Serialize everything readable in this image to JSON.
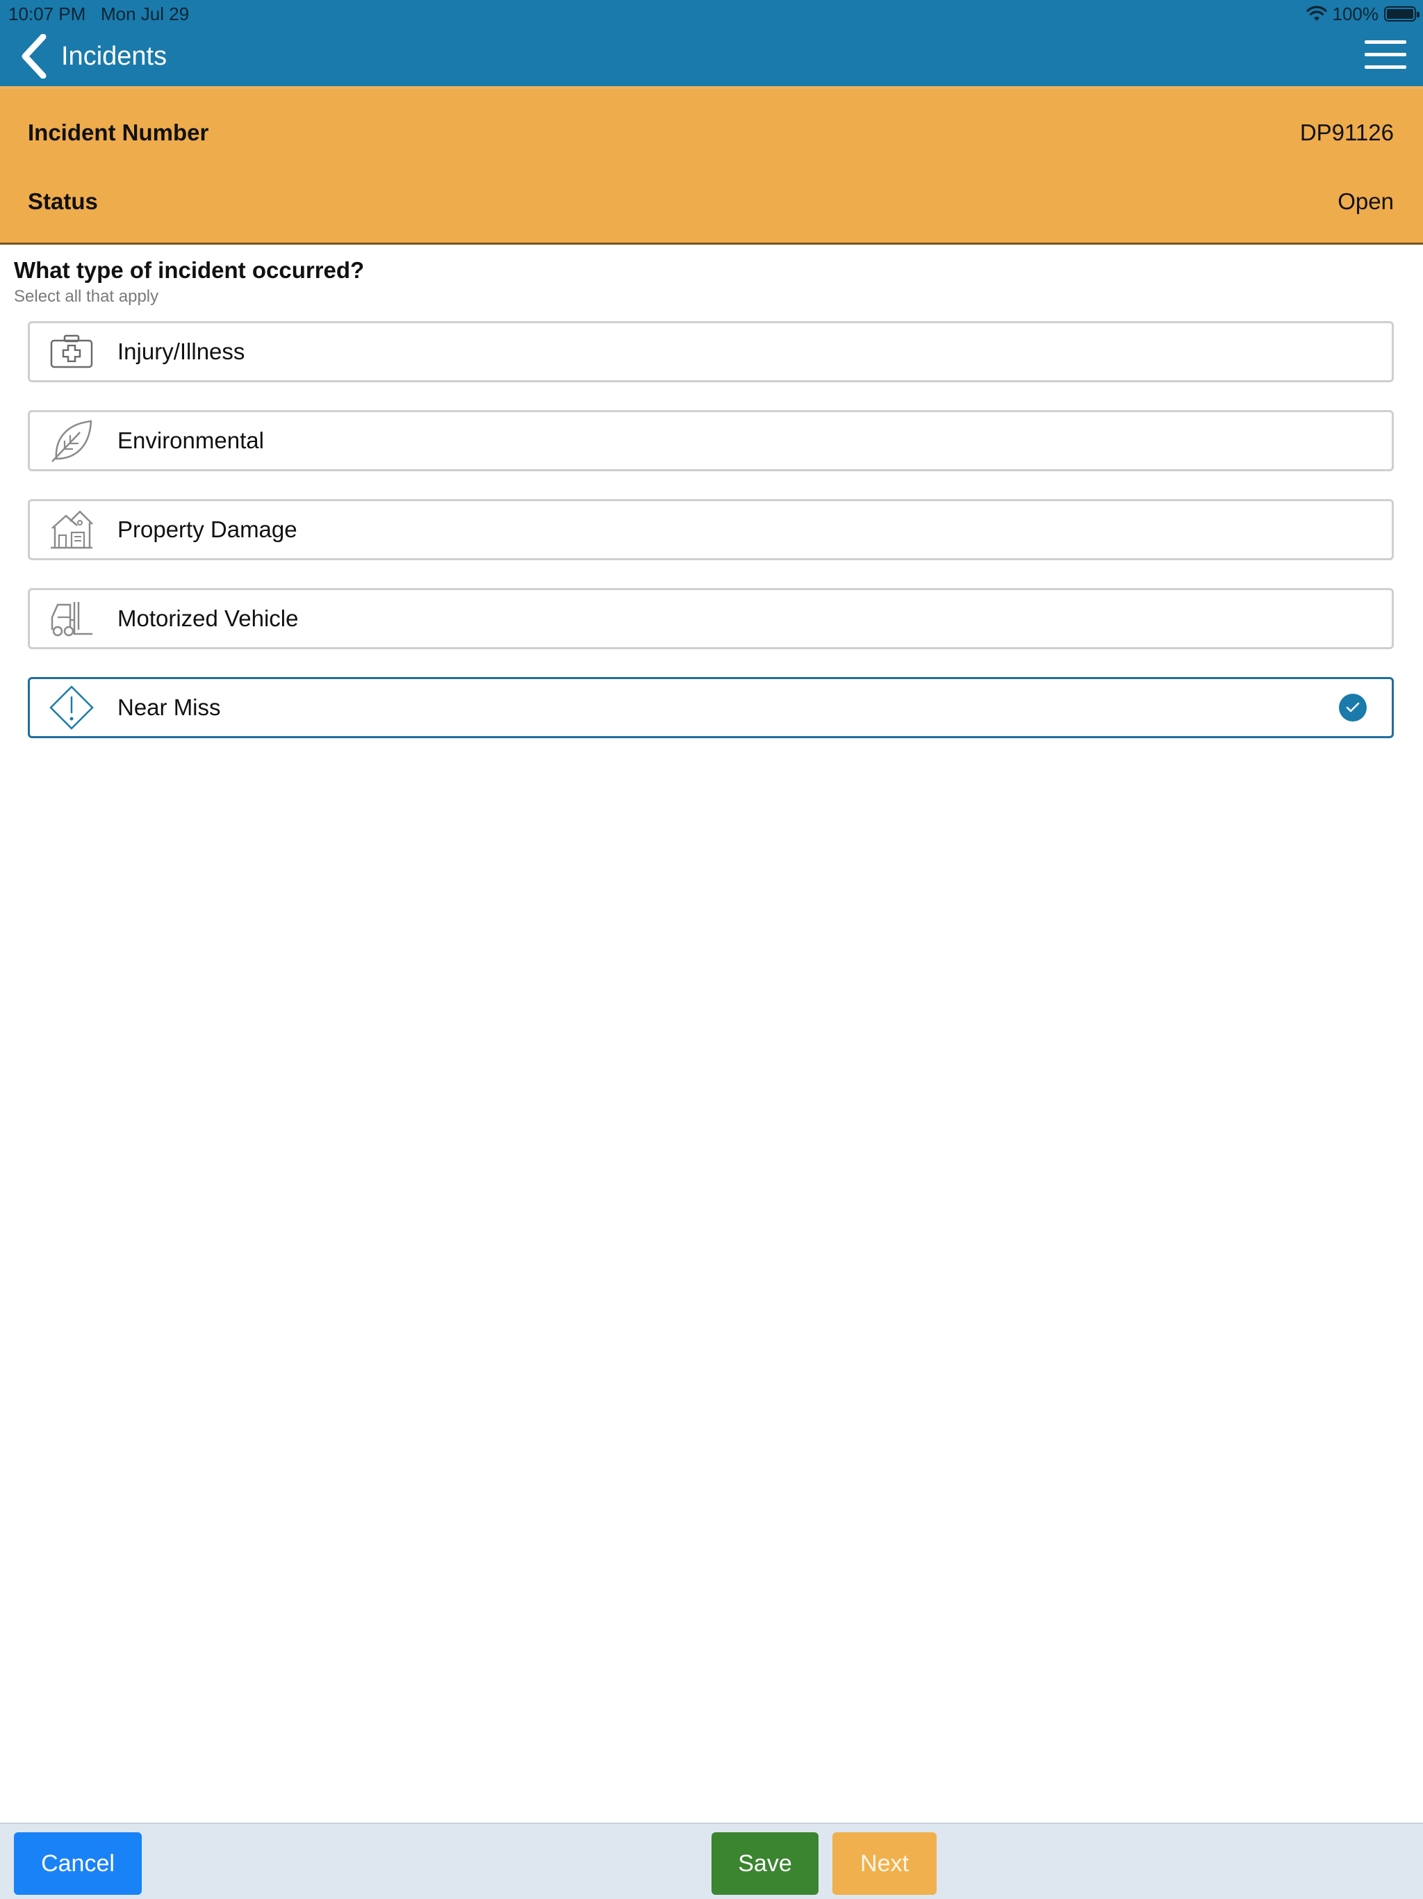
{
  "status_bar": {
    "time": "10:07 PM",
    "date": "Mon Jul 29",
    "battery": "100%",
    "battery_level": 1.0
  },
  "nav": {
    "title": "Incidents",
    "back_icon": "chevron-left-icon",
    "menu_icon": "hamburger-menu-icon"
  },
  "info": {
    "incident_number_label": "Incident Number",
    "incident_number_value": "DP91126",
    "status_label": "Status",
    "status_value": "Open"
  },
  "question": {
    "title": "What type of incident occurred?",
    "hint": "Select all that apply"
  },
  "options": [
    {
      "label": "Injury/Illness",
      "icon": "first-aid-kit-icon",
      "selected": false
    },
    {
      "label": "Environmental",
      "icon": "leaf-icon",
      "selected": false
    },
    {
      "label": "Property Damage",
      "icon": "building-icon",
      "selected": false
    },
    {
      "label": "Motorized Vehicle",
      "icon": "forklift-icon",
      "selected": false
    },
    {
      "label": "Near Miss",
      "icon": "warning-diamond-icon",
      "selected": true
    }
  ],
  "footer": {
    "cancel_label": "Cancel",
    "save_label": "Save",
    "next_label": "Next"
  },
  "colors": {
    "header_blue": "#1a7aab",
    "info_orange": "#eeac4d",
    "selected_border": "#1e6f9c",
    "cancel_blue": "#1a82f7",
    "save_green": "#3b8430",
    "next_orange": "#f0b04d"
  }
}
